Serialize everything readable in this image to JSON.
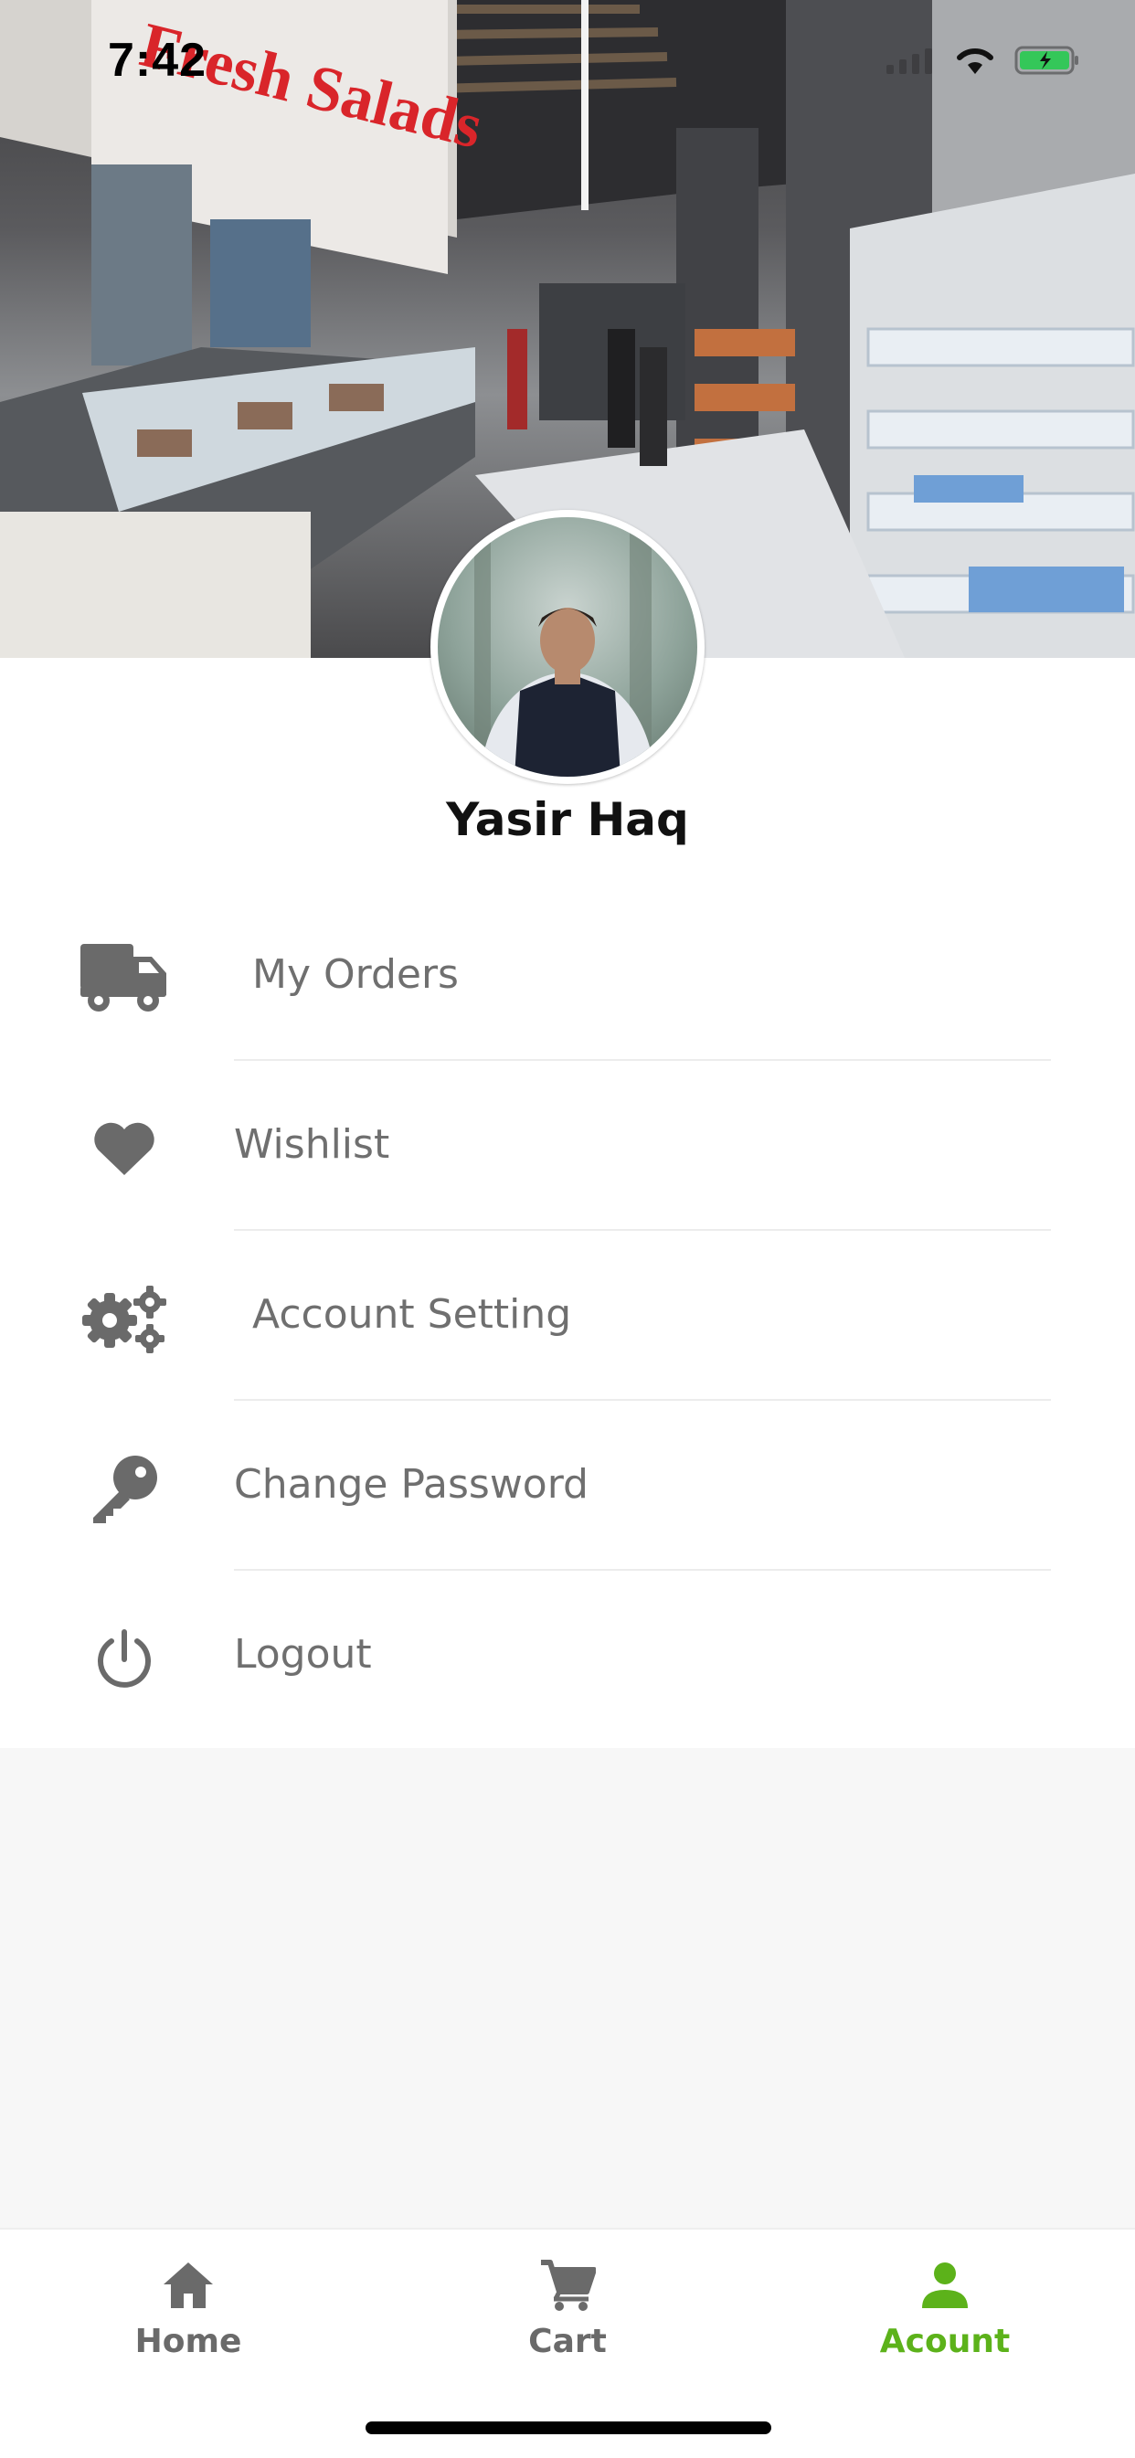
{
  "status_bar": {
    "time": "7:42"
  },
  "profile": {
    "name": "Yasir Haq"
  },
  "menu": [
    {
      "label": "My Orders",
      "icon": "truck-icon"
    },
    {
      "label": "Wishlist",
      "icon": "heart-icon"
    },
    {
      "label": "Account Setting",
      "icon": "gears-icon"
    },
    {
      "label": "Change Password",
      "icon": "key-icon"
    },
    {
      "label": "Logout",
      "icon": "power-icon"
    }
  ],
  "tabbar": {
    "items": [
      {
        "label": "Home",
        "icon": "home-icon"
      },
      {
        "label": "Cart",
        "icon": "cart-icon"
      },
      {
        "label": "Acount",
        "icon": "user-icon"
      }
    ],
    "active_index": 2
  },
  "colors": {
    "accent": "#5cb21a",
    "icon_gray": "#6a6a6a",
    "label_gray": "#6f6f6f"
  }
}
